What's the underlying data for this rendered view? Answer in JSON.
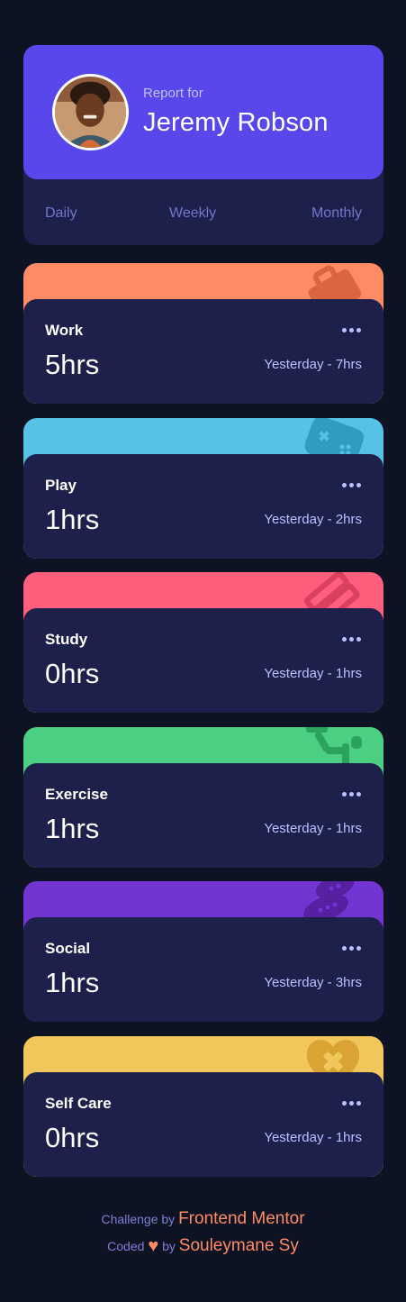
{
  "profile": {
    "report_for": "Report for",
    "name": "Jeremy Robson"
  },
  "tabs": [
    "Daily",
    "Weekly",
    "Monthly"
  ],
  "cards": [
    {
      "title": "Work",
      "hours": "5hrs",
      "previous": "Yesterday - 7hrs",
      "color": "#ff8b64",
      "icon": "work-briefcase-icon"
    },
    {
      "title": "Play",
      "hours": "1hrs",
      "previous": "Yesterday - 2hrs",
      "color": "#55c2e6",
      "icon": "play-gamepad-icon"
    },
    {
      "title": "Study",
      "hours": "0hrs",
      "previous": "Yesterday - 1hrs",
      "color": "#ff5e7d",
      "icon": "study-books-icon"
    },
    {
      "title": "Exercise",
      "hours": "1hrs",
      "previous": "Yesterday - 1hrs",
      "color": "#4bcf82",
      "icon": "exercise-runner-icon"
    },
    {
      "title": "Social",
      "hours": "1hrs",
      "previous": "Yesterday - 3hrs",
      "color": "#7335d2",
      "icon": "social-speech-bubbles-icon"
    },
    {
      "title": "Self Care",
      "hours": "0hrs",
      "previous": "Yesterday - 1hrs",
      "color": "#f1c75b",
      "icon": "self-care-heart-icon"
    }
  ],
  "footer": {
    "challenge_by": "Challenge by",
    "challenge_link": "Frontend Mentor",
    "coded": "Coded",
    "by": "by",
    "author_link": "Souleymane Sy"
  },
  "colors": {
    "page_bg": "#0e1323",
    "card_bg": "#1c204b",
    "profile_accent": "#5847eb",
    "link": "#ff8b64"
  }
}
